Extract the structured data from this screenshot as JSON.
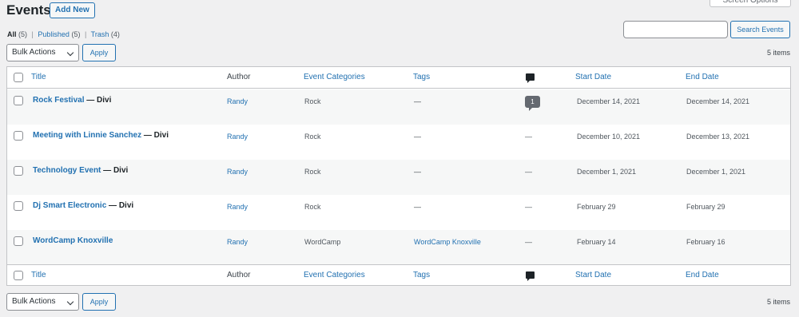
{
  "header": {
    "title": "Events",
    "add_new_label": "Add New",
    "screen_options_label": "Screen Options"
  },
  "views": {
    "all_label": "All",
    "all_count": "(5)",
    "published_label": "Published",
    "published_count": "(5)",
    "trash_label": "Trash",
    "trash_count": "(4)",
    "separator": "|"
  },
  "search": {
    "value": "",
    "button_label": "Search Events"
  },
  "bulk_actions": {
    "selected": "Bulk Actions",
    "apply_label": "Apply"
  },
  "items_count": "5 items",
  "columns": {
    "title": "Title",
    "author": "Author",
    "categories": "Event Categories",
    "tags": "Tags",
    "start": "Start Date",
    "end": "End Date",
    "comments_icon": "comment-icon"
  },
  "rows": [
    {
      "title": "Rock Festival",
      "state": " — Divi",
      "author": "Randy",
      "category": "Rock",
      "tags": "—",
      "comments": "1",
      "start": "December 14, 2021",
      "end": "December 14, 2021"
    },
    {
      "title": "Meeting with Linnie Sanchez",
      "state": " — Divi",
      "author": "Randy",
      "category": "Rock",
      "tags": "—",
      "comments": "—",
      "start": "December 10, 2021",
      "end": "December 13, 2021"
    },
    {
      "title": "Technology Event",
      "state": " — Divi",
      "author": "Randy",
      "category": "Rock",
      "tags": "—",
      "comments": "—",
      "start": "December 1, 2021",
      "end": "December 1, 2021"
    },
    {
      "title": "Dj Smart Electronic",
      "state": " — Divi",
      "author": "Randy",
      "category": "Rock",
      "tags": "—",
      "comments": "—",
      "start": "February 29",
      "end": "February 29"
    },
    {
      "title": "WordCamp Knoxville",
      "state": "",
      "author": "Randy",
      "category": "WordCamp",
      "tags": "WordCamp Knoxville",
      "comments": "—",
      "start": "February 14",
      "end": "February 16"
    }
  ],
  "colors": {
    "link": "#2271b1",
    "stripe": "#f6f7f7",
    "background": "#f0f0f1"
  }
}
